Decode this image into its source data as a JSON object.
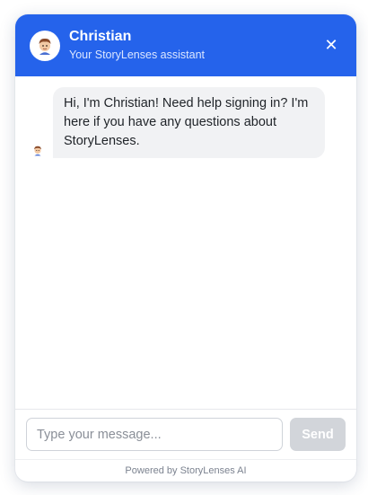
{
  "colors": {
    "header_bg": "#2563eb",
    "bubble_bg": "#f1f2f4",
    "send_disabled": "#d2d5da"
  },
  "header": {
    "avatar_icon": "person-avatar-icon",
    "name": "Christian",
    "subtitle": "Your StoryLenses assistant",
    "close_icon": "close-icon",
    "close_glyph": "✕"
  },
  "messages": [
    {
      "sender": "assistant",
      "avatar_icon": "person-avatar-icon",
      "text": "Hi, I'm Christian! Need help signing in? I'm here if you have any questions about StoryLenses."
    }
  ],
  "composer": {
    "placeholder": "Type your message...",
    "value": "",
    "send_label": "Send"
  },
  "footer": {
    "text": "Powered by StoryLenses AI"
  }
}
